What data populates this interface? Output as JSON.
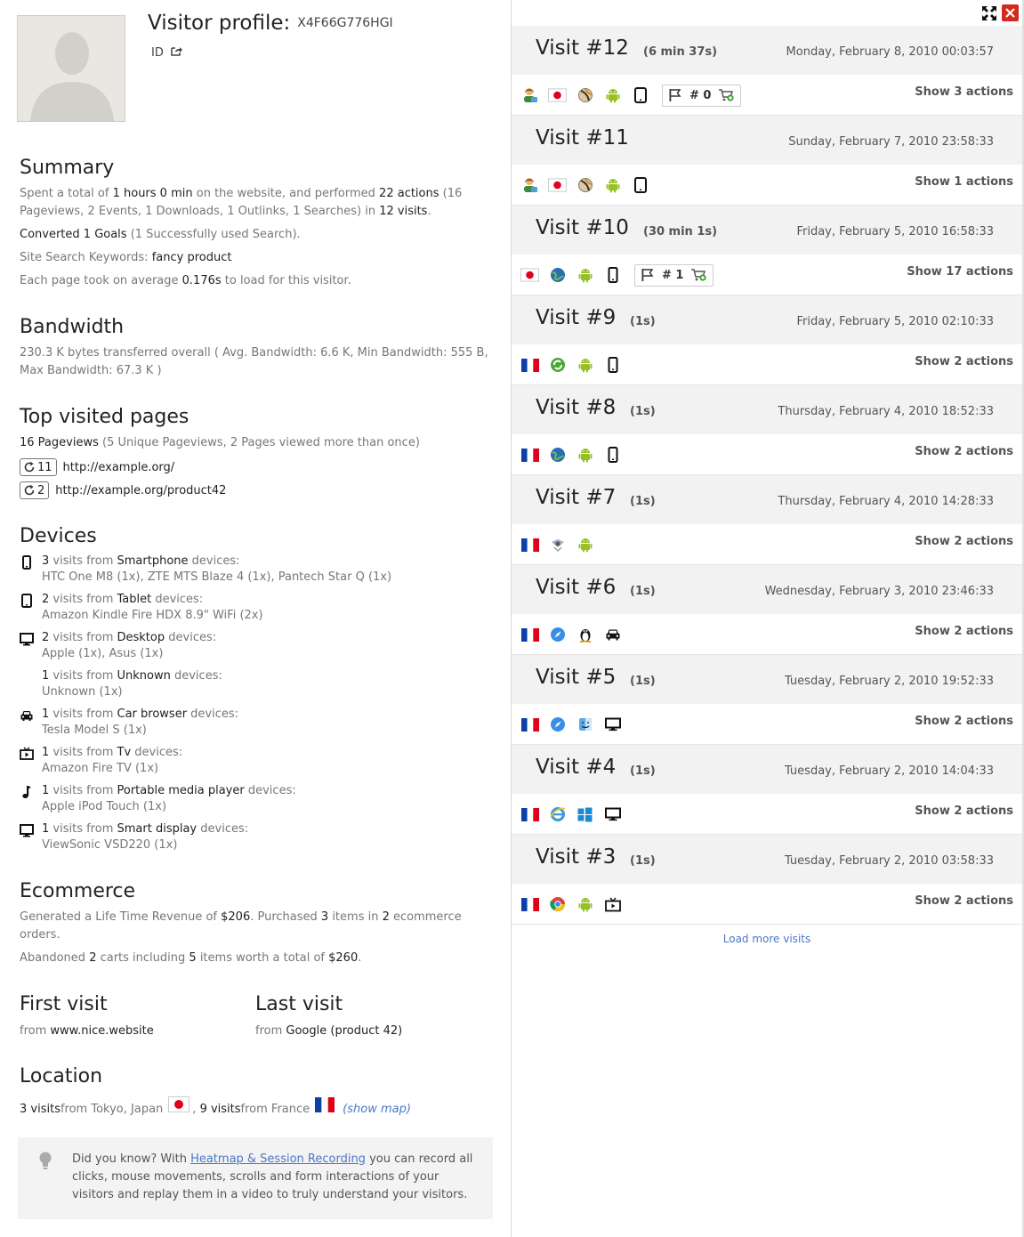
{
  "profile": {
    "title": "Visitor profile:",
    "visitor_id": "X4F66G776HGI",
    "id_label": "ID"
  },
  "summary": {
    "heading": "Summary",
    "p1": {
      "a": "Spent a total of ",
      "time": "1 hours 0 min",
      "b": " on the website, and performed ",
      "actions": "22 actions",
      "c": " (16 Pageviews, 2 Events, 1 Downloads, 1 Outlinks, 1 Searches) in ",
      "visits": "12 visits",
      "d": "."
    },
    "p2": {
      "goals": "Converted 1 Goals",
      "rest": " (1 Successfully used Search)."
    },
    "p3": {
      "label": "Site Search Keywords: ",
      "keyword": "fancy product"
    },
    "p4": {
      "a": "Each page took on average ",
      "time": "0.176s",
      "b": " to load for this visitor."
    }
  },
  "bandwidth": {
    "heading": "Bandwidth",
    "text": "230.3 K bytes transferred overall ( Avg. Bandwidth: 6.6 K, Min Bandwidth: 555 B, Max Bandwidth: 67.3 K )"
  },
  "top_pages": {
    "heading": "Top visited pages",
    "pageviews": "16 Pageviews",
    "rest": " (5 Unique Pageviews, 2 Pages viewed more than once)",
    "pages": [
      {
        "count": "11",
        "url": "http://example.org/"
      },
      {
        "count": "2",
        "url": "http://example.org/product42"
      }
    ]
  },
  "devices": {
    "heading": "Devices",
    "items": [
      {
        "icon": "smartphone-icon",
        "count": "3",
        "mid": " visits from ",
        "type": "Smartphone",
        "suffix": " devices:",
        "models": "HTC One M8 (1x), ZTE MTS Blaze 4 (1x), Pantech Star Q (1x)"
      },
      {
        "icon": "tablet-icon",
        "count": "2",
        "mid": " visits from ",
        "type": "Tablet",
        "suffix": " devices:",
        "models": "Amazon Kindle Fire HDX 8.9\" WiFi (2x)"
      },
      {
        "icon": "desktop-icon",
        "count": "2",
        "mid": " visits from ",
        "type": "Desktop",
        "suffix": " devices:",
        "models": "Apple (1x), Asus (1x)"
      },
      {
        "icon": "",
        "count": "1",
        "mid": " visits from ",
        "type": "Unknown",
        "suffix": " devices:",
        "models": "Unknown (1x)"
      },
      {
        "icon": "car-icon",
        "count": "1",
        "mid": " visits from ",
        "type": "Car browser",
        "suffix": " devices:",
        "models": "Tesla Model S (1x)"
      },
      {
        "icon": "tv-icon",
        "count": "1",
        "mid": " visits from ",
        "type": "Tv",
        "suffix": " devices:",
        "models": "Amazon Fire TV (1x)"
      },
      {
        "icon": "music-note-icon",
        "count": "1",
        "mid": " visits from ",
        "type": "Portable media player",
        "suffix": " devices:",
        "models": "Apple iPod Touch (1x)"
      },
      {
        "icon": "smart-display-icon",
        "count": "1",
        "mid": " visits from ",
        "type": "Smart display",
        "suffix": " devices:",
        "models": "ViewSonic VSD220 (1x)"
      }
    ]
  },
  "ecommerce": {
    "heading": "Ecommerce",
    "p1": {
      "a": "Generated a Life Time Revenue of ",
      "revenue": "$206",
      "b": ". Purchased ",
      "items": "3",
      "c": " items in ",
      "orders": "2",
      "d": " ecommerce orders."
    },
    "p2": {
      "a": "Abandoned ",
      "carts": "2",
      "b": " carts including ",
      "items": "5",
      "c": " items worth a total of ",
      "total": "$260",
      "d": "."
    }
  },
  "first_visit": {
    "heading": "First visit",
    "from": "from ",
    "source": "www.nice.website"
  },
  "last_visit": {
    "heading": "Last visit",
    "from": "from ",
    "source": "Google (product 42)"
  },
  "location": {
    "heading": "Location",
    "a_visits": "3 visits",
    "a_from": " from Tokyo, Japan",
    "sep": ",",
    "b_visits": "9 visits",
    "b_from": " from France",
    "show_map": "(show map)"
  },
  "tip": {
    "a": "Did you know? With ",
    "link": "Heatmap & Session Recording",
    "b": " you can record all clicks, mouse movements, scrolls and form interactions of your visitors and replay them in a video to truly understand your visitors."
  },
  "visits": [
    {
      "title": "Visit #12",
      "duration": "(6 min 37s)",
      "date": "Monday, February 8, 2010 00:03:57",
      "show": "Show 3 actions",
      "icons": [
        "visitor-icon",
        "flag-japan-icon",
        "browser-icon",
        "android-icon",
        "tablet-icon"
      ],
      "goal": "# 0"
    },
    {
      "title": "Visit #11",
      "duration": "",
      "date": "Sunday, February 7, 2010 23:58:33",
      "show": "Show 1 actions",
      "icons": [
        "visitor-icon",
        "flag-japan-icon",
        "browser-icon",
        "android-icon",
        "tablet-icon"
      ],
      "goal": ""
    },
    {
      "title": "Visit #10",
      "duration": "(30 min 1s)",
      "date": "Friday, February 5, 2010 16:58:33",
      "show": "Show 17 actions",
      "icons": [
        "flag-japan-icon",
        "globe-browser-icon",
        "android-icon",
        "smartphone-icon"
      ],
      "goal": "# 1"
    },
    {
      "title": "Visit #9",
      "duration": "(1s)",
      "date": "Friday, February 5, 2010 02:10:33",
      "show": "Show 2 actions",
      "icons": [
        "flag-france-icon",
        "green-browser-icon",
        "android-icon",
        "smartphone-icon"
      ],
      "goal": ""
    },
    {
      "title": "Visit #8",
      "duration": "(1s)",
      "date": "Thursday, February 4, 2010 18:52:33",
      "show": "Show 2 actions",
      "icons": [
        "flag-france-icon",
        "globe-browser-icon",
        "android-icon",
        "smartphone-icon"
      ],
      "goal": ""
    },
    {
      "title": "Visit #7",
      "duration": "(1s)",
      "date": "Thursday, February 4, 2010 14:28:33",
      "show": "Show 2 actions",
      "icons": [
        "flag-france-icon",
        "bot-browser-icon",
        "android-icon"
      ],
      "goal": ""
    },
    {
      "title": "Visit #6",
      "duration": "(1s)",
      "date": "Wednesday, February 3, 2010 23:46:33",
      "show": "Show 2 actions",
      "icons": [
        "flag-france-icon",
        "safari-icon",
        "linux-icon",
        "car-icon"
      ],
      "goal": ""
    },
    {
      "title": "Visit #5",
      "duration": "(1s)",
      "date": "Tuesday, February 2, 2010 19:52:33",
      "show": "Show 2 actions",
      "icons": [
        "flag-france-icon",
        "safari-icon",
        "mac-finder-icon",
        "desktop-icon"
      ],
      "goal": ""
    },
    {
      "title": "Visit #4",
      "duration": "(1s)",
      "date": "Tuesday, February 2, 2010 14:04:33",
      "show": "Show 2 actions",
      "icons": [
        "flag-france-icon",
        "ie-icon",
        "windows-icon",
        "desktop-icon"
      ],
      "goal": ""
    },
    {
      "title": "Visit #3",
      "duration": "(1s)",
      "date": "Tuesday, February 2, 2010 03:58:33",
      "show": "Show 2 actions",
      "icons": [
        "flag-france-icon",
        "chrome-icon",
        "android-icon",
        "tv-icon"
      ],
      "goal": ""
    }
  ],
  "load_more": "Load more visits"
}
